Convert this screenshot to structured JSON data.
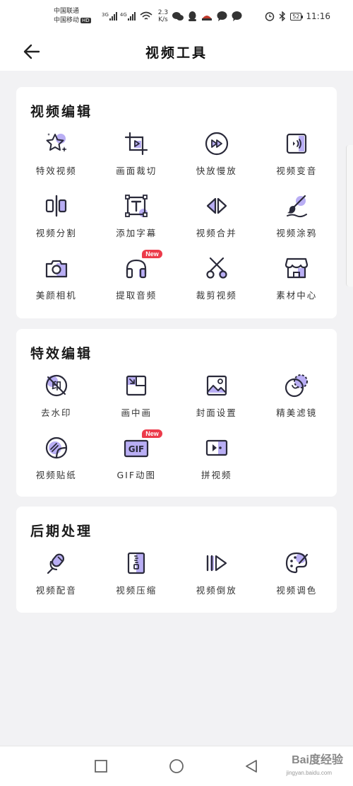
{
  "status": {
    "carrier1": "中国联通",
    "carrier2": "中国移动",
    "hd": "HD",
    "net1": "3G",
    "net2": "4G",
    "speed_value": "2.3",
    "speed_unit": "K/s",
    "battery": "52",
    "time": "11:16"
  },
  "header": {
    "title": "视频工具",
    "back_icon": "arrow-left-icon"
  },
  "sections": [
    {
      "title": "视频编辑",
      "items": [
        {
          "label": "特效视频",
          "icon": "sparkle-star-icon"
        },
        {
          "label": "画面裁切",
          "icon": "crop-icon"
        },
        {
          "label": "快放慢放",
          "icon": "fast-forward-icon"
        },
        {
          "label": "视频变音",
          "icon": "voice-change-icon"
        },
        {
          "label": "视频分割",
          "icon": "split-icon"
        },
        {
          "label": "添加字幕",
          "icon": "text-icon"
        },
        {
          "label": "视频合并",
          "icon": "merge-icon"
        },
        {
          "label": "视频涂鸦",
          "icon": "brush-icon"
        },
        {
          "label": "美颜相机",
          "icon": "camera-icon"
        },
        {
          "label": "提取音频",
          "icon": "headphones-icon",
          "badge": "New"
        },
        {
          "label": "裁剪视频",
          "icon": "scissors-icon"
        },
        {
          "label": "素材中心",
          "icon": "store-icon"
        }
      ]
    },
    {
      "title": "特效编辑",
      "items": [
        {
          "label": "去水印",
          "icon": "watermark-remove-icon",
          "glyph": "印"
        },
        {
          "label": "画中画",
          "icon": "picture-in-picture-icon"
        },
        {
          "label": "封面设置",
          "icon": "image-icon"
        },
        {
          "label": "精美滤镜",
          "icon": "filter-icon"
        },
        {
          "label": "视频贴纸",
          "icon": "sticker-icon"
        },
        {
          "label": "GIF动图",
          "icon": "gif-icon",
          "badge": "New",
          "glyph": "GIF"
        },
        {
          "label": "拼视频",
          "icon": "video-collage-icon"
        }
      ]
    },
    {
      "title": "后期处理",
      "items": [
        {
          "label": "视频配音",
          "icon": "microphone-icon"
        },
        {
          "label": "视频压缩",
          "icon": "compress-icon"
        },
        {
          "label": "视频倒放",
          "icon": "reverse-play-icon"
        },
        {
          "label": "视频调色",
          "icon": "palette-icon"
        }
      ]
    }
  ],
  "nav": {
    "recent": "square-icon",
    "home": "circle-icon",
    "back": "triangle-back-icon"
  },
  "watermark": {
    "text": "Bai度经验",
    "sub": "jingyan.baidu.com"
  },
  "colors": {
    "accent": "#8d7be8",
    "accent_light": "#c6bcf5",
    "icon_stroke": "#2a2a3a",
    "badge": "#ec3a4a"
  }
}
